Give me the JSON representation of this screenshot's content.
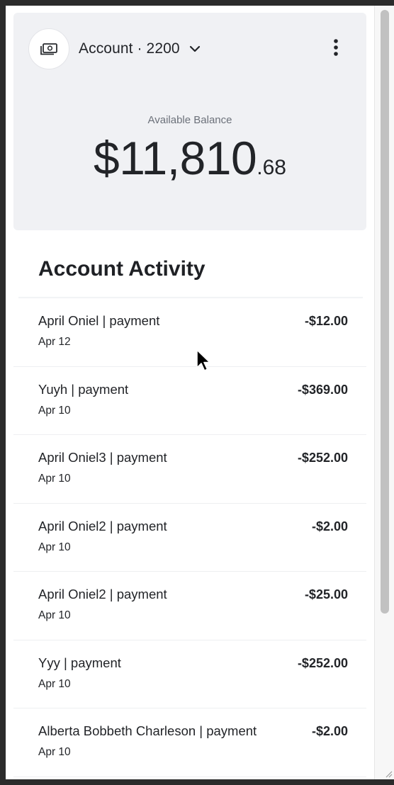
{
  "account": {
    "icon": "cash-icon",
    "selector_label": "Account · 2200",
    "dropdown_icon": "chevron-down-icon",
    "menu_icon": "more-vertical-icon"
  },
  "balance": {
    "label": "Available Balance",
    "dollars": "$11,810",
    "cents": ".68"
  },
  "activity": {
    "title": "Account Activity",
    "transactions": [
      {
        "name": "April Oniel | payment",
        "date": "Apr 12",
        "amount": "-$12.00"
      },
      {
        "name": "Yuyh | payment",
        "date": "Apr 10",
        "amount": "-$369.00"
      },
      {
        "name": "April Oniel3 | payment",
        "date": "Apr 10",
        "amount": "-$252.00"
      },
      {
        "name": "April Oniel2 | payment",
        "date": "Apr 10",
        "amount": "-$2.00"
      },
      {
        "name": "April Oniel2 | payment",
        "date": "Apr 10",
        "amount": "-$25.00"
      },
      {
        "name": "Yyy | payment",
        "date": "Apr 10",
        "amount": "-$252.00"
      },
      {
        "name": "Alberta Bobbeth Charleson | payment",
        "date": "Apr 10",
        "amount": "-$2.00"
      }
    ]
  },
  "colors": {
    "header_background": "#f0f1f4",
    "text_primary": "#222428",
    "text_muted": "#6c717a"
  }
}
